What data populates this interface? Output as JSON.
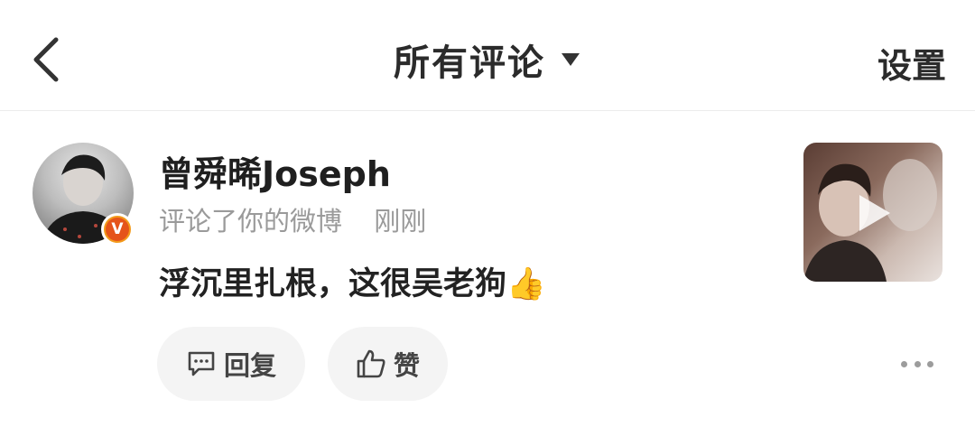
{
  "header": {
    "title": "所有评论",
    "settings_label": "设置"
  },
  "comment": {
    "username": "曾舜晞Joseph",
    "action": "评论了你的微博",
    "time": "刚刚",
    "text": "浮沉里扎根，这很吴老狗👍",
    "verified_badge": "V",
    "reply_label": "回复",
    "like_label": "赞"
  },
  "icons": {
    "back": "chevron-left-icon",
    "dropdown": "caret-down-icon",
    "reply": "comment-bubble-icon",
    "like": "thumbs-up-icon",
    "more": "more-dots-icon",
    "play": "play-icon"
  },
  "colors": {
    "badge_outer": "#f39a1b",
    "badge_inner": "#e5541a",
    "muted_text": "#9a9a9a",
    "button_bg": "#f4f4f4"
  }
}
